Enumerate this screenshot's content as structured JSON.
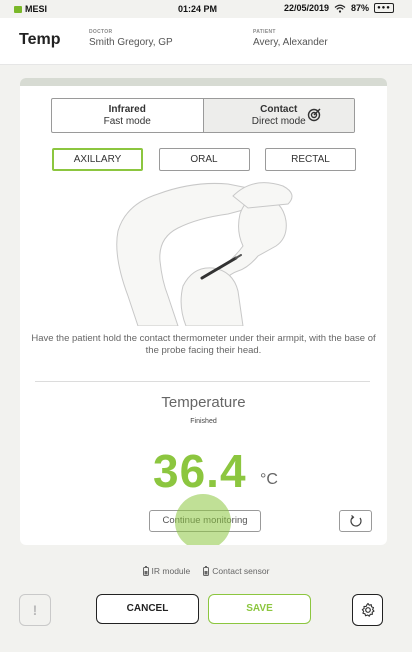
{
  "status_bar": {
    "carrier": "MESI",
    "time": "01:24 PM",
    "date": "22/05/2019",
    "battery": "87%"
  },
  "header": {
    "title": "Temp",
    "doctor_label": "DOCTOR",
    "doctor_name": "Smith Gregory, GP",
    "patient_label": "PATIENT",
    "patient_name": "Avery, Alexander"
  },
  "modes": [
    {
      "title": "Infrared",
      "subtitle": "Fast mode",
      "active": false
    },
    {
      "title": "Contact",
      "subtitle": "Direct mode",
      "active": true,
      "icon": "target-icon"
    }
  ],
  "sites": [
    {
      "label": "AXILLARY",
      "active": true
    },
    {
      "label": "ORAL",
      "active": false
    },
    {
      "label": "RECTAL",
      "active": false
    }
  ],
  "instruction": "Have the patient hold the contact thermometer under their armpit, with the base of the probe facing their head.",
  "measurement": {
    "label": "Temperature",
    "status": "Finished",
    "value": "36.4",
    "unit": "°C"
  },
  "continue_button": "Continue monitoring",
  "sensors": [
    {
      "label": "IR module",
      "icon": "battery-icon"
    },
    {
      "label": "Contact sensor",
      "icon": "battery-icon"
    }
  ],
  "actions": {
    "cancel": "CANCEL",
    "save": "SAVE"
  },
  "colors": {
    "accent": "#8cc63f",
    "text": "#333333",
    "background": "#f2f2ef"
  }
}
